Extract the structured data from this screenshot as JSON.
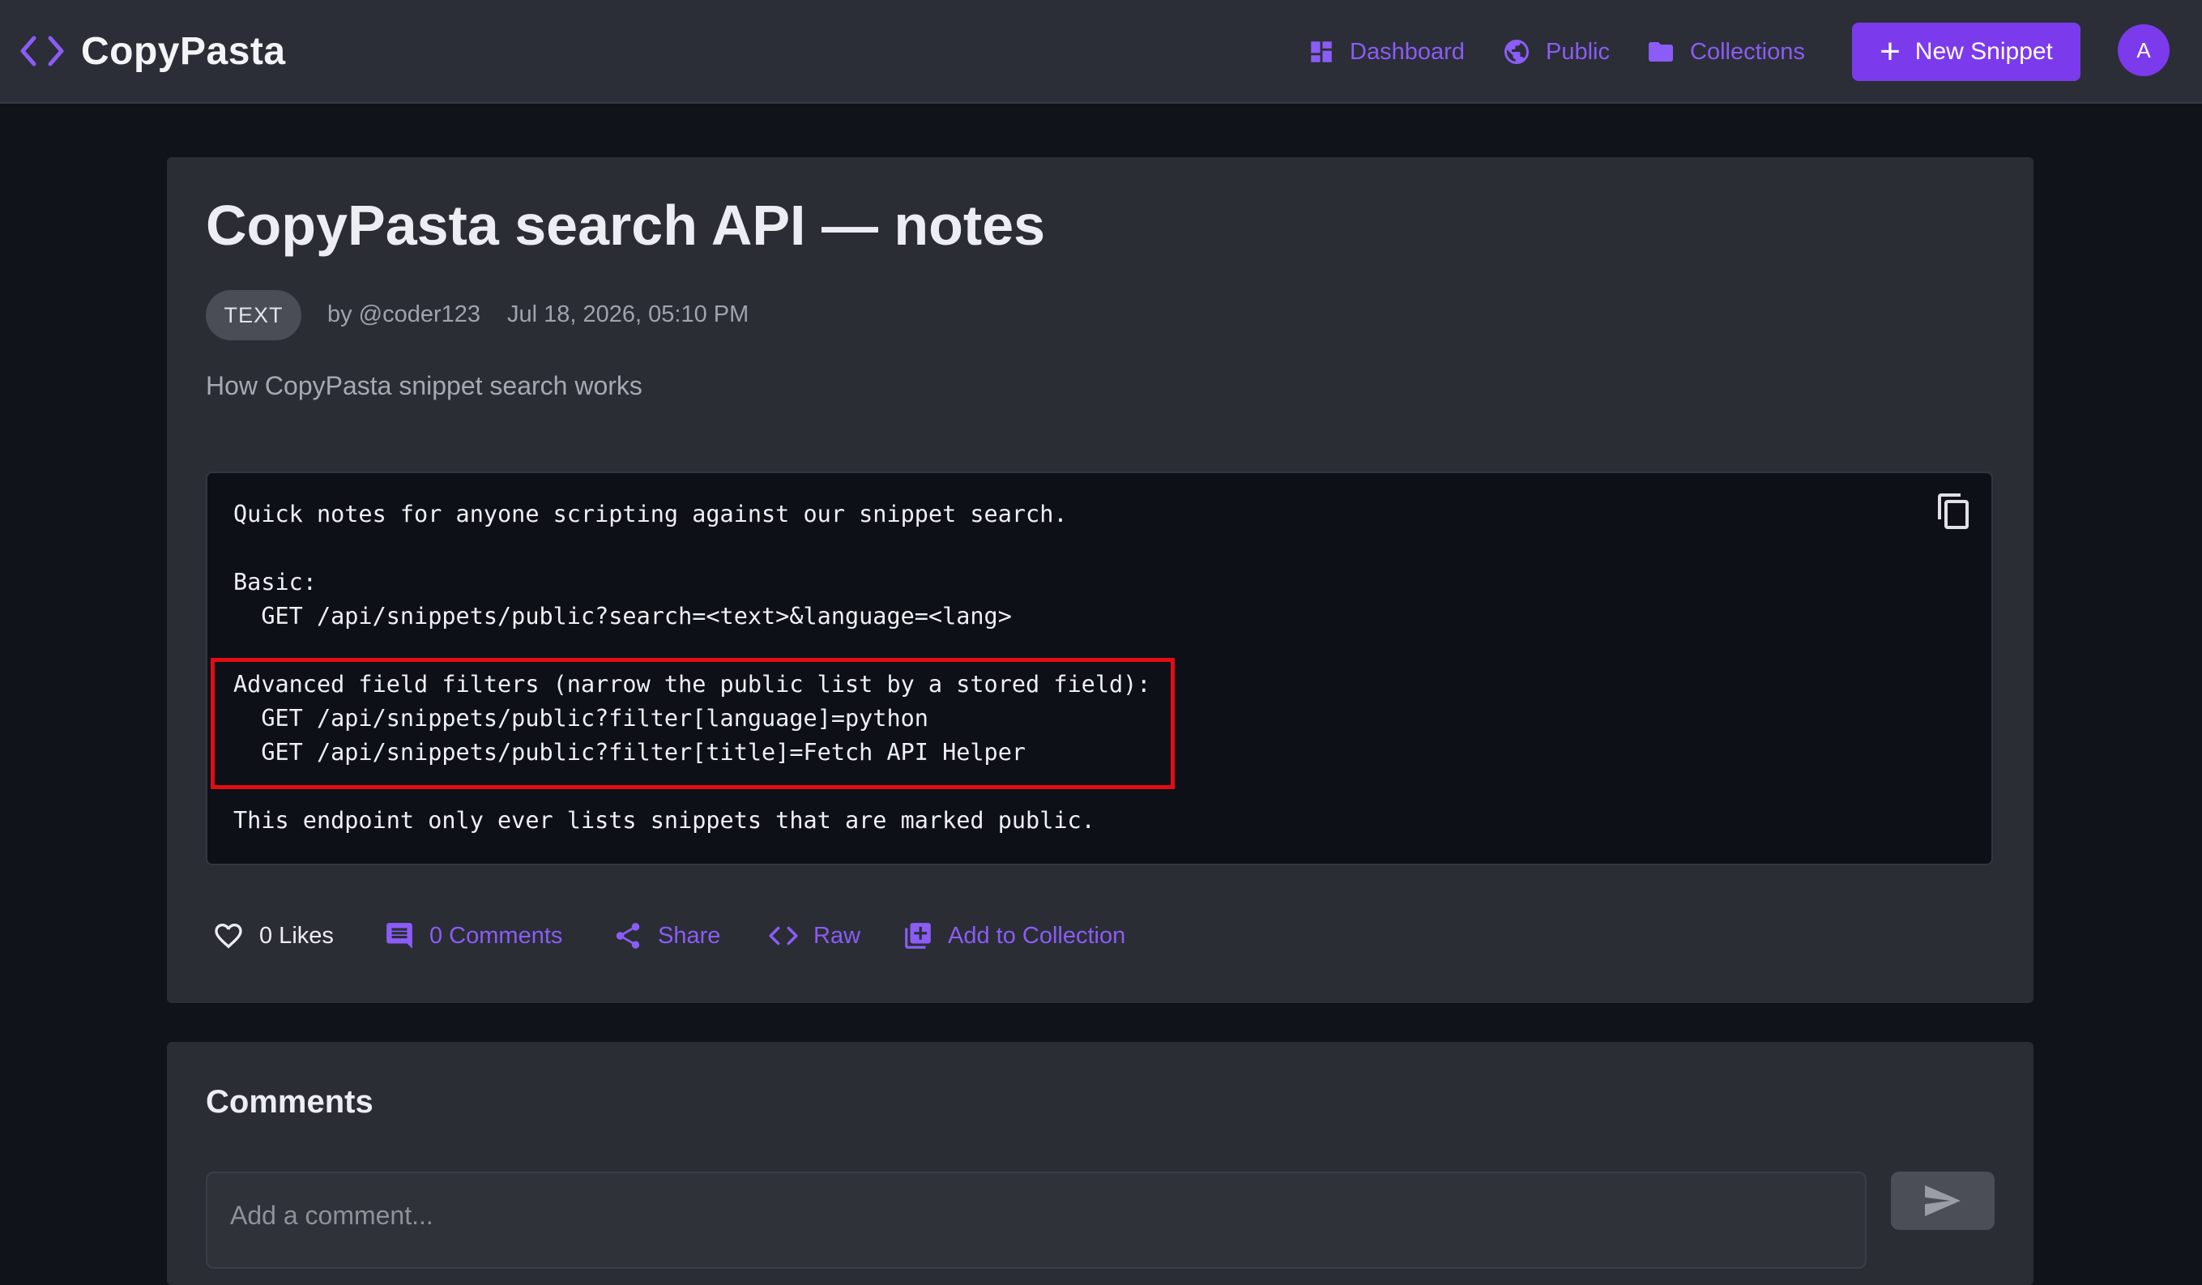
{
  "header": {
    "app_name": "CopyPasta",
    "nav": [
      {
        "label": "Dashboard",
        "icon": "dashboard-icon"
      },
      {
        "label": "Public",
        "icon": "globe-icon"
      },
      {
        "label": "Collections",
        "icon": "folder-icon"
      }
    ],
    "new_snippet_label": "New Snippet",
    "avatar_initial": "A"
  },
  "snippet": {
    "title": "CopyPasta search API — notes",
    "language": "TEXT",
    "author": "by @coder123",
    "date": "Jul 18, 2026, 05:10 PM",
    "description": "How CopyPasta snippet search works",
    "code_lines": [
      "Quick notes for anyone scripting against our snippet search.",
      "",
      "Basic:",
      "  GET /api/snippets/public?search=<text>&language=<lang>",
      "",
      "Advanced field filters (narrow the public list by a stored field):",
      "  GET /api/snippets/public?filter[language]=python",
      "  GET /api/snippets/public?filter[title]=Fetch API Helper",
      "",
      "This endpoint only ever lists snippets that are marked public."
    ],
    "highlight_color": "#e10d12"
  },
  "actions": {
    "likes": "0 Likes",
    "comments": "0 Comments",
    "share": "Share",
    "raw": "Raw",
    "add_to_collection": "Add to Collection"
  },
  "comments": {
    "title": "Comments",
    "placeholder": "Add a comment..."
  },
  "colors": {
    "accent": "#7c3aed",
    "link": "#8b5cf6",
    "background": "#10131a",
    "card": "#2a2d34",
    "header": "#2b2e36"
  }
}
